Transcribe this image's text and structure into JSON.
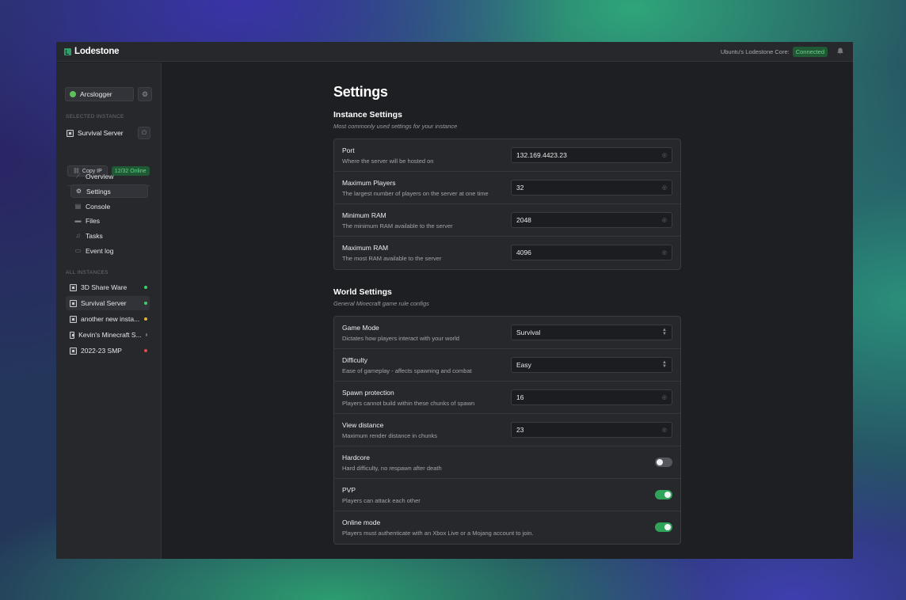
{
  "app": {
    "name": "Lodestone"
  },
  "topbar": {
    "core_label": "Ubuntu's Lodestone Core:",
    "status": "Connected"
  },
  "sidebar": {
    "user": "Arcslogger",
    "selected_label": "SELECTED INSTANCE",
    "selected_instance": "Survival Server",
    "copy_ip": "Copy IP",
    "online": "12/32 Online",
    "nav": [
      {
        "label": "Overview",
        "icon": "chart-icon"
      },
      {
        "label": "Settings",
        "icon": "gear-icon"
      },
      {
        "label": "Console",
        "icon": "terminal-icon"
      },
      {
        "label": "Files",
        "icon": "folder-icon"
      },
      {
        "label": "Tasks",
        "icon": "tasks-icon"
      },
      {
        "label": "Event log",
        "icon": "inbox-icon"
      }
    ],
    "all_label": "ALL INSTANCES",
    "instances": [
      {
        "name": "3D Share Ware",
        "status_color": "#3ecf6a"
      },
      {
        "name": "Survival Server",
        "status_color": "#3ecf6a"
      },
      {
        "name": "another new insta...",
        "status_color": "#e0b23a"
      },
      {
        "name": "Kevin's Minecraft S...",
        "status_color": "#6d6f76"
      },
      {
        "name": "2022-23 SMP",
        "status_color": "#e5484d"
      }
    ]
  },
  "main": {
    "title": "Settings",
    "instance_settings": {
      "title": "Instance Settings",
      "subtitle": "Most commonly used settings for your instance",
      "rows": [
        {
          "label": "Port",
          "desc": "Where the server will be hosted on",
          "value": "132.169.4423.23"
        },
        {
          "label": "Maximum Players",
          "desc": "The largest number of players on the server at one time",
          "value": "32"
        },
        {
          "label": "Minimum RAM",
          "desc": "The minimum RAM available to the server",
          "value": "2048"
        },
        {
          "label": "Maximum RAM",
          "desc": "The most RAM available to the server",
          "value": "4096"
        }
      ]
    },
    "world_settings": {
      "title": "World Settings",
      "subtitle": "General Minecraft game rule configs",
      "rows": [
        {
          "label": "Game Mode",
          "desc": "Dictates how players interact with your world",
          "value": "Survival"
        },
        {
          "label": "Difficulty",
          "desc": "Ease of gameplay - affects spawning and combat",
          "value": "Easy"
        },
        {
          "label": "Spawn protection",
          "desc": "Players cannot build within these chunks of spawn",
          "value": "16"
        },
        {
          "label": "View distance",
          "desc": "Maximum render distance in chunks",
          "value": "23"
        },
        {
          "label": "Hardcore",
          "desc": "Hard difficulty, no respawn after death",
          "enabled": false
        },
        {
          "label": "PVP",
          "desc": "Players can attack each other",
          "enabled": true
        },
        {
          "label": "Online mode",
          "desc": "Players must authenticate with an Xbox Live or a Mojang account to join.",
          "enabled": true
        }
      ]
    }
  }
}
